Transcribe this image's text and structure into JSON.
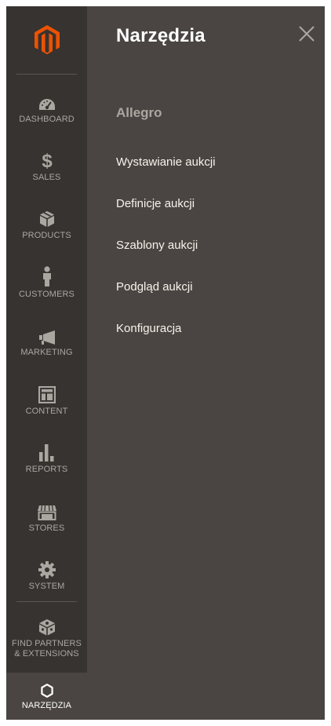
{
  "sidebar": {
    "logo_icon": "magento-logo",
    "items": [
      {
        "label": "DASHBOARD",
        "icon": "speedometer-icon"
      },
      {
        "label": "SALES",
        "icon": "dollar-icon"
      },
      {
        "label": "PRODUCTS",
        "icon": "cube-icon"
      },
      {
        "label": "CUSTOMERS",
        "icon": "person-icon"
      },
      {
        "label": "MARKETING",
        "icon": "megaphone-icon"
      },
      {
        "label": "CONTENT",
        "icon": "layout-icon"
      },
      {
        "label": "REPORTS",
        "icon": "bar-chart-icon"
      },
      {
        "label": "STORES",
        "icon": "storefront-icon"
      },
      {
        "label": "SYSTEM",
        "icon": "gear-icon"
      },
      {
        "label": "FIND PARTNERS\n& EXTENSIONS",
        "icon": "partners-cube-icon"
      },
      {
        "label": "NARZĘDZIA",
        "icon": "hexagon-icon",
        "active": true
      }
    ]
  },
  "panel": {
    "title": "Narzędzia",
    "close_icon": "close-icon",
    "section_title": "Allegro",
    "links": [
      "Wystawianie aukcji",
      "Definicje aukcji",
      "Szablony aukcji",
      "Podgląd aukcji",
      "Konfiguracja"
    ]
  },
  "colors": {
    "sidebar_bg": "#373330",
    "panel_bg": "#4a4542",
    "logo_orange": "#eb5202",
    "icon_gray": "#aaa6a0",
    "text_white": "#ffffff"
  }
}
